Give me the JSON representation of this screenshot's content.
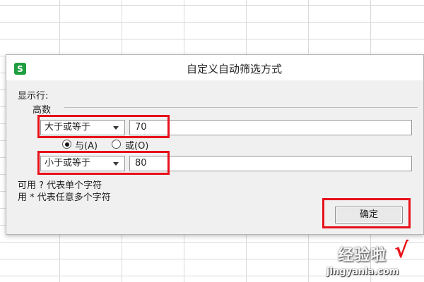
{
  "dialog": {
    "title": "自定义自动筛选方式",
    "app_icon": "S",
    "show_rows_label": "显示行:",
    "field_name": "高数",
    "condition1": {
      "operator": "大于或等于",
      "value": "70"
    },
    "logic": {
      "and_label": "与(A)",
      "or_label": "或(O)",
      "selected": "and"
    },
    "condition2": {
      "operator": "小于或等于",
      "value": "80"
    },
    "hint1": "可用 ? 代表单个字符",
    "hint2": "用 * 代表任意多个字符",
    "ok_label": "确定"
  },
  "watermark": {
    "brand": "经验啦",
    "check": "√",
    "url": "jingyanla.com"
  },
  "colors": {
    "highlight": "#e8101a",
    "app_icon": "#1e9e3e"
  }
}
